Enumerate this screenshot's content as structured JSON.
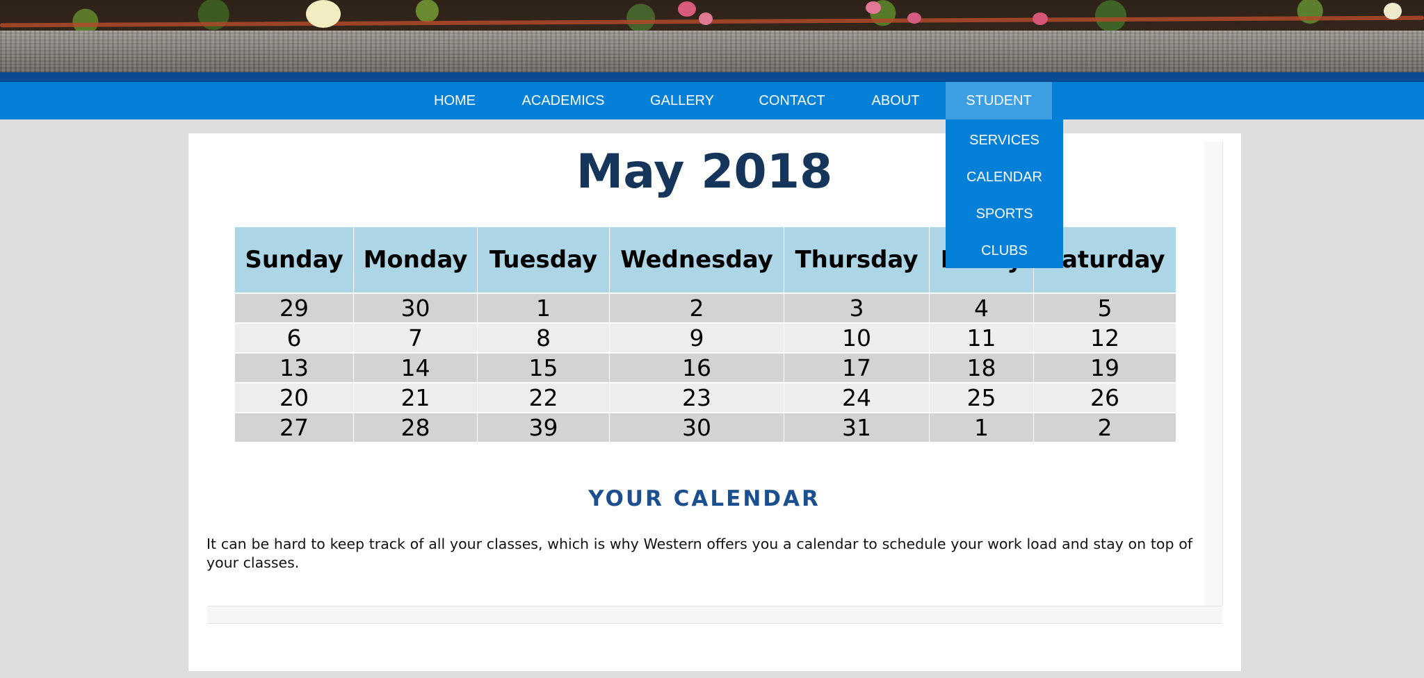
{
  "nav": {
    "items": [
      {
        "label": "HOME"
      },
      {
        "label": "ACADEMICS"
      },
      {
        "label": "GALLERY"
      },
      {
        "label": "CONTACT"
      },
      {
        "label": "ABOUT"
      },
      {
        "label": "STUDENT",
        "active": true
      }
    ],
    "dropdown": [
      {
        "label": "SERVICES"
      },
      {
        "label": "CALENDAR"
      },
      {
        "label": "SPORTS"
      },
      {
        "label": "CLUBS"
      }
    ]
  },
  "calendar": {
    "title": "May 2018",
    "days": [
      "Sunday",
      "Monday",
      "Tuesday",
      "Wednesday",
      "Thursday",
      "Friday",
      "Saturday"
    ],
    "weeks": [
      [
        "29",
        "30",
        "1",
        "2",
        "3",
        "4",
        "5"
      ],
      [
        "6",
        "7",
        "8",
        "9",
        "10",
        "11",
        "12"
      ],
      [
        "13",
        "14",
        "15",
        "16",
        "17",
        "18",
        "19"
      ],
      [
        "20",
        "21",
        "22",
        "23",
        "24",
        "25",
        "26"
      ],
      [
        "27",
        "28",
        "39",
        "30",
        "31",
        "1",
        "2"
      ]
    ]
  },
  "section": {
    "title": "YOUR CALENDAR",
    "text": "It can be hard to keep track of all your classes, which is why Western offers you a calendar to schedule your work load and stay on top of your classes."
  },
  "colors": {
    "nav_bg": "#0580d8",
    "nav_active": "#3d9fe3",
    "header_strip": "#0a4a93",
    "title": "#16355a",
    "table_header": "#acd6e6",
    "row_dark": "#d3d3d3",
    "row_light": "#ededed",
    "section_title": "#1b4f8f"
  }
}
